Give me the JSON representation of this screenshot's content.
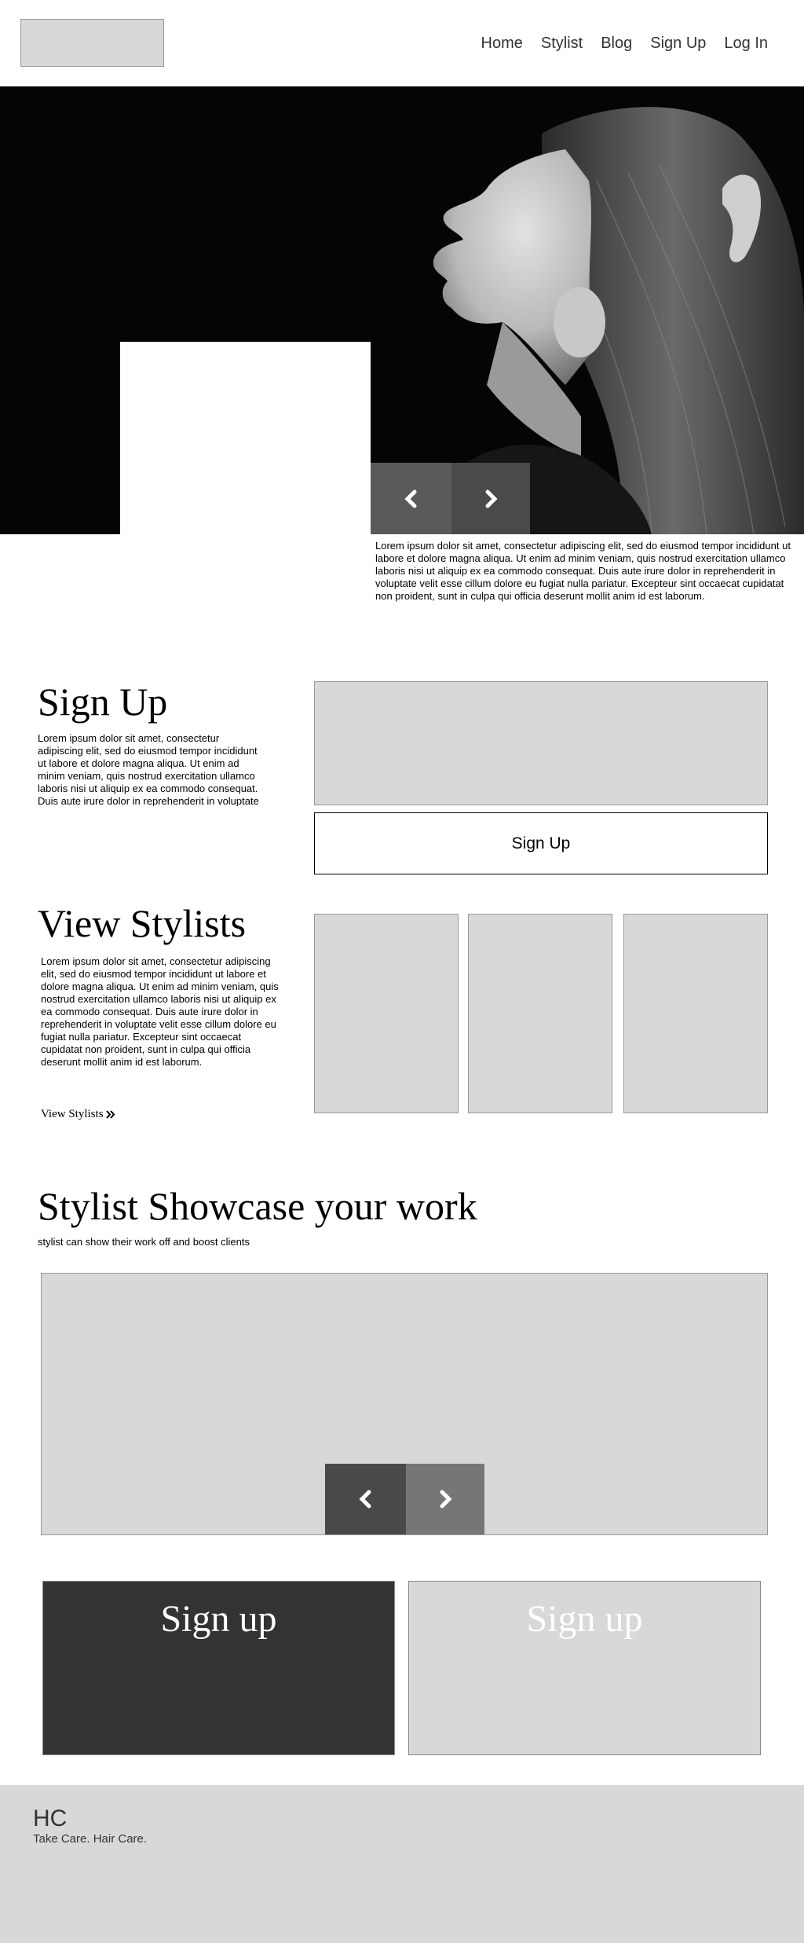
{
  "header": {
    "nav": [
      "Home",
      "Stylist",
      "Blog",
      "Sign Up",
      "Log In"
    ]
  },
  "hero": {
    "caption": "Lorem ipsum dolor sit amet, consectetur adipiscing elit, sed do eiusmod tempor incididunt ut labore et dolore magna aliqua. Ut enim ad minim veniam, quis nostrud exercitation ullamco laboris nisi ut aliquip ex ea commodo consequat. Duis aute irure dolor in reprehenderit in voluptate velit esse cillum dolore eu fugiat nulla pariatur. Excepteur sint occaecat cupidatat non proident, sunt in culpa qui officia deserunt mollit anim id est laborum.",
    "prev_icon": "chevron-left-icon",
    "next_icon": "chevron-right-icon"
  },
  "signup": {
    "title": "Sign Up",
    "text": "Lorem ipsum dolor sit amet, consectetur adipiscing elit, sed do eiusmod tempor incididunt ut labore et dolore magna aliqua. Ut enim ad minim veniam, quis nostrud exercitation ullamco laboris nisi ut aliquip ex ea commodo consequat. Duis aute irure dolor in reprehenderit in voluptate",
    "button_label": "Sign Up"
  },
  "stylists": {
    "title": "View Stylists",
    "text": "Lorem ipsum dolor sit amet, consectetur adipiscing elit, sed do eiusmod tempor incididunt ut labore et dolore magna aliqua. Ut enim ad minim veniam, quis nostrud exercitation ullamco laboris nisi ut aliquip ex ea commodo consequat. Duis aute irure dolor in reprehenderit in voluptate velit esse cillum dolore eu fugiat nulla pariatur. Excepteur sint occaecat cupidatat non proident, sunt in culpa qui officia deserunt mollit anim id est laborum.",
    "link_label": "View Stylists",
    "link_icon": "double-chevron-right-icon"
  },
  "showcase": {
    "title": "Stylist Showcase your work",
    "subtitle": "stylist can show their work off and boost clients"
  },
  "signup_cards": [
    {
      "label": "Sign up",
      "bg": "#333333"
    },
    {
      "label": "Sign up",
      "bg": "#d8d8d8"
    }
  ],
  "footer": {
    "brand": "HC",
    "tagline": "Take Care. Hair Care."
  },
  "colors": {
    "placeholder": "#d8d8d8",
    "hero_bg": "#050505",
    "dark_card": "#333333"
  }
}
